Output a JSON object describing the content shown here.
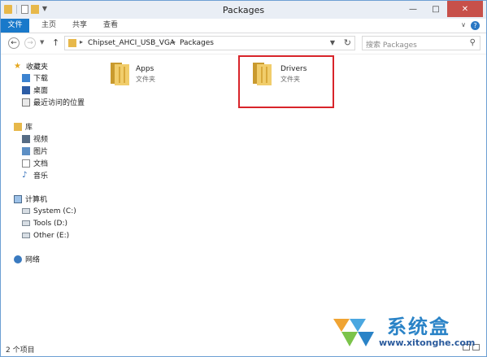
{
  "window": {
    "title": "Packages"
  },
  "ribbon": {
    "tabs": [
      "文件",
      "主页",
      "共享",
      "查看"
    ]
  },
  "address": {
    "breadcrumbs": [
      "Chipset_AHCI_USB_VGA",
      "Packages"
    ],
    "search_placeholder": "搜索 Packages"
  },
  "sidebar": {
    "favorites": {
      "label": "收藏夹",
      "items": [
        "下载",
        "桌面",
        "最近访问的位置"
      ]
    },
    "libraries": {
      "label": "库",
      "items": [
        "视频",
        "图片",
        "文档",
        "音乐"
      ]
    },
    "computer": {
      "label": "计算机",
      "items": [
        "System (C:)",
        "Tools (D:)",
        "Other (E:)"
      ]
    },
    "network": {
      "label": "网络"
    }
  },
  "files": [
    {
      "name": "Apps",
      "type": "文件夹"
    },
    {
      "name": "Drivers",
      "type": "文件夹"
    }
  ],
  "status": {
    "count": "2 个项目"
  },
  "watermark": {
    "text": "系统盒",
    "url": "www.xitonghe.com"
  },
  "colors": {
    "accent": "#1979ca",
    "highlight": "#d8242a",
    "folder": "#e7b84a"
  }
}
